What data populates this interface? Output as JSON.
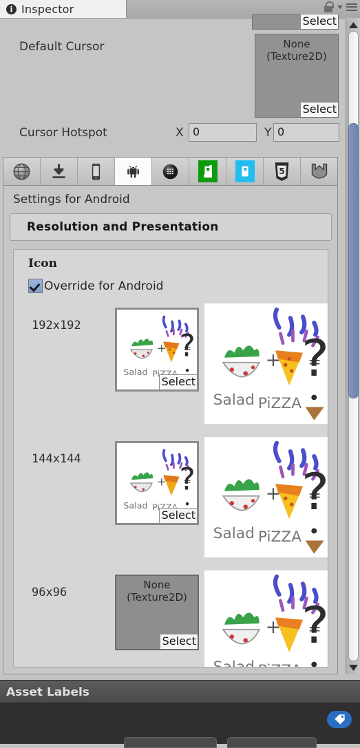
{
  "window": {
    "tab_label": "Inspector",
    "tab_icon": "info-circle-icon",
    "lock_icon": "unlocked-padlock-icon",
    "dropdown_icon": "chevron-down-icon",
    "menu_icon": "hamburger-menu-icon"
  },
  "cursor_section": {
    "partial_field_select": "Select",
    "default_cursor_label": "Default Cursor",
    "default_cursor_value": "None",
    "default_cursor_type": "(Texture2D)",
    "default_cursor_select": "Select",
    "hotspot_label": "Cursor Hotspot",
    "hotspot_x_label": "X",
    "hotspot_x_value": "0",
    "hotspot_y_label": "Y",
    "hotspot_y_value": "0"
  },
  "platform_tabs": [
    {
      "name": "web-player",
      "icon": "globe-icon",
      "selected": false
    },
    {
      "name": "standalone",
      "icon": "download-arrow-icon",
      "selected": false
    },
    {
      "name": "ios",
      "icon": "iphone-icon",
      "selected": false
    },
    {
      "name": "android",
      "icon": "android-robot-icon",
      "selected": true
    },
    {
      "name": "blackberry",
      "icon": "blackberry-icon",
      "selected": false
    },
    {
      "name": "windows-store",
      "icon": "windows-store-icon",
      "selected": false
    },
    {
      "name": "windows-phone",
      "icon": "windows-phone-icon",
      "selected": false
    },
    {
      "name": "html5",
      "icon": "html5-shield-icon",
      "selected": false
    },
    {
      "name": "flash",
      "icon": "flash-icon",
      "selected": false
    }
  ],
  "settings": {
    "title": "Settings for Android",
    "foldout_label": "Resolution and Presentation"
  },
  "icon_section": {
    "header": "Icon",
    "override_label": "Override for Android",
    "override_checked": true,
    "rows": [
      {
        "size": "192x192",
        "has_texture": true,
        "select_label": "Select",
        "none_value": "",
        "none_type": ""
      },
      {
        "size": "144x144",
        "has_texture": true,
        "select_label": "Select",
        "none_value": "",
        "none_type": ""
      },
      {
        "size": "96x96",
        "has_texture": false,
        "select_label": "Select",
        "none_value": "None",
        "none_type": "(Texture2D)"
      }
    ],
    "artwork": {
      "caption_left": "Salad",
      "caption_right": "PiZZA",
      "plus": "+",
      "equals": "=",
      "question": "?"
    }
  },
  "scrollbar": {
    "up_icon": "triangle-up-icon",
    "down_icon": "triangle-down-icon"
  },
  "asset_labels": {
    "title": "Asset Labels",
    "tag_icon": "tag-icon"
  },
  "colors": {
    "panel_bg": "#c5c5c5",
    "box_bg": "#d6d6d6",
    "accent_blue": "#7fa0ce",
    "scroll_thumb": "#7788b3",
    "tag_blue": "#2a6ec4",
    "android_green": "#0d9b0d",
    "wp_cyan": "#21bdef"
  }
}
